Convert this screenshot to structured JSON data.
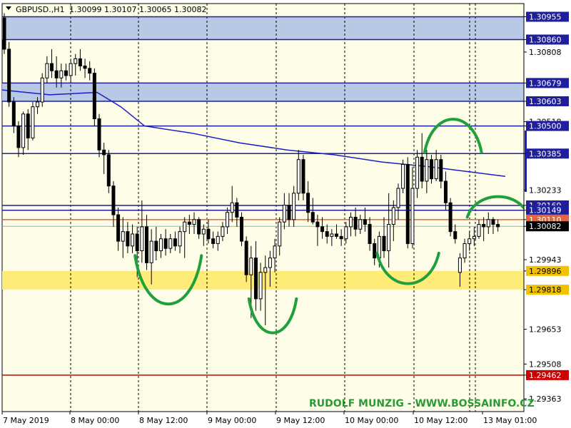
{
  "header": {
    "symbol": "GBPUSD.,H1",
    "ohlc": "1.30099 1.30107 1.30065 1.30082"
  },
  "watermark": "RUDOLF MUNZIG - WWW.BOSSAINFO.CZ",
  "colors": {
    "plot_background": "#fdfde8",
    "candle_bull": "#ffffff",
    "candle_bear": "#000000",
    "blue_zone": "#b7c9e4",
    "yellow_zone": "#ffec78",
    "level_line": "#1f1f9c",
    "ma_line": "#1c1cc8",
    "support_red": "#cc0000",
    "pattern_green": "#1f9f3d",
    "watermark": "#2a9a36"
  },
  "chart_data": {
    "type": "candlestick",
    "title": "GBPUSD.,H1",
    "ylim": [
      1.2931,
      1.3101
    ],
    "price_ticks": [
      "1.30955",
      "1.30860",
      "1.30808",
      "1.30679",
      "1.30603",
      "1.30518",
      "1.30500",
      "1.30385",
      "1.30233",
      "1.30169",
      "1.30149",
      "1.30110",
      "1.30082",
      "1.29943",
      "1.29896",
      "1.29818",
      "1.29653",
      "1.29508",
      "1.29462",
      "1.29363"
    ],
    "time_labels": [
      "7 May 2019",
      "8 May 00:00",
      "8 May 12:00",
      "9 May 00:00",
      "9 May 12:00",
      "10 May 00:00",
      "10 May 12:00",
      "13 May 01:00"
    ],
    "current_price": 1.30082,
    "zones": [
      {
        "from": 1.3086,
        "to": 1.30955,
        "kind": "resistance"
      },
      {
        "from": 1.30603,
        "to": 1.30679,
        "kind": "resistance"
      },
      {
        "from": 1.29818,
        "to": 1.29896,
        "kind": "support"
      }
    ],
    "levels": [
      {
        "price": 1.30955,
        "color": "#1f1f9c"
      },
      {
        "price": 1.3086,
        "color": "#1f1f9c"
      },
      {
        "price": 1.30679,
        "color": "#1f1f9c"
      },
      {
        "price": 1.30603,
        "color": "#1f1f9c"
      },
      {
        "price": 1.305,
        "color": "#1f1f9c"
      },
      {
        "price": 1.30385,
        "color": "#1f1f9c"
      },
      {
        "price": 1.30169,
        "color": "#1f1f9c"
      },
      {
        "price": 1.30149,
        "color": "#1f1f9c"
      },
      {
        "price": 1.3011,
        "color": "#e2663a"
      },
      {
        "price": 1.30082,
        "color": "#aaaaaa"
      },
      {
        "price": 1.29462,
        "color": "#cc0000"
      }
    ],
    "series": [
      {
        "type": "candlestick",
        "candles": [
          {
            "o": 1.3095,
            "h": 1.3097,
            "l": 1.308,
            "c": 1.3082
          },
          {
            "o": 1.3082,
            "h": 1.3085,
            "l": 1.3058,
            "c": 1.306
          },
          {
            "o": 1.306,
            "h": 1.3062,
            "l": 1.3047,
            "c": 1.305
          },
          {
            "o": 1.305,
            "h": 1.3052,
            "l": 1.3037,
            "c": 1.3041
          },
          {
            "o": 1.3041,
            "h": 1.3056,
            "l": 1.3038,
            "c": 1.3055
          },
          {
            "o": 1.3055,
            "h": 1.3057,
            "l": 1.304,
            "c": 1.3045
          },
          {
            "o": 1.3045,
            "h": 1.306,
            "l": 1.3044,
            "c": 1.3058
          },
          {
            "o": 1.3058,
            "h": 1.3062,
            "l": 1.3055,
            "c": 1.306
          },
          {
            "o": 1.306,
            "h": 1.3072,
            "l": 1.3058,
            "c": 1.307
          },
          {
            "o": 1.307,
            "h": 1.3079,
            "l": 1.3068,
            "c": 1.3076
          },
          {
            "o": 1.3076,
            "h": 1.3082,
            "l": 1.307,
            "c": 1.3073
          },
          {
            "o": 1.3073,
            "h": 1.3079,
            "l": 1.3066,
            "c": 1.307
          },
          {
            "o": 1.307,
            "h": 1.3076,
            "l": 1.3066,
            "c": 1.3073
          },
          {
            "o": 1.3073,
            "h": 1.3076,
            "l": 1.3069,
            "c": 1.3071
          },
          {
            "o": 1.3071,
            "h": 1.3078,
            "l": 1.3068,
            "c": 1.3076
          },
          {
            "o": 1.3076,
            "h": 1.308,
            "l": 1.3071,
            "c": 1.3078
          },
          {
            "o": 1.3078,
            "h": 1.3082,
            "l": 1.3073,
            "c": 1.3075
          },
          {
            "o": 1.3075,
            "h": 1.3078,
            "l": 1.307,
            "c": 1.3074
          },
          {
            "o": 1.3074,
            "h": 1.3077,
            "l": 1.3069,
            "c": 1.3072
          },
          {
            "o": 1.3072,
            "h": 1.3074,
            "l": 1.305,
            "c": 1.3053
          },
          {
            "o": 1.3053,
            "h": 1.3055,
            "l": 1.3037,
            "c": 1.304
          },
          {
            "o": 1.304,
            "h": 1.3043,
            "l": 1.303,
            "c": 1.3038
          },
          {
            "o": 1.3038,
            "h": 1.304,
            "l": 1.3022,
            "c": 1.3025
          },
          {
            "o": 1.3025,
            "h": 1.3027,
            "l": 1.3008,
            "c": 1.3013
          },
          {
            "o": 1.3013,
            "h": 1.3016,
            "l": 1.2998,
            "c": 1.3002
          },
          {
            "o": 1.3002,
            "h": 1.3012,
            "l": 1.2995,
            "c": 1.3006
          },
          {
            "o": 1.3006,
            "h": 1.301,
            "l": 1.2997,
            "c": 1.3
          },
          {
            "o": 1.3,
            "h": 1.3009,
            "l": 1.2997,
            "c": 1.3005
          },
          {
            "o": 1.3005,
            "h": 1.3008,
            "l": 1.2987,
            "c": 1.2998
          },
          {
            "o": 1.2998,
            "h": 1.3019,
            "l": 1.2993,
            "c": 1.3008
          },
          {
            "o": 1.3008,
            "h": 1.3013,
            "l": 1.299,
            "c": 1.2993
          },
          {
            "o": 1.2993,
            "h": 1.3007,
            "l": 1.2984,
            "c": 1.3002
          },
          {
            "o": 1.3002,
            "h": 1.3008,
            "l": 1.2994,
            "c": 1.2998
          },
          {
            "o": 1.2998,
            "h": 1.3005,
            "l": 1.2995,
            "c": 1.3003
          },
          {
            "o": 1.3003,
            "h": 1.3007,
            "l": 1.2996,
            "c": 1.2999
          },
          {
            "o": 1.2999,
            "h": 1.3005,
            "l": 1.2997,
            "c": 1.3003
          },
          {
            "o": 1.3003,
            "h": 1.3006,
            "l": 1.2998,
            "c": 1.3
          },
          {
            "o": 1.3,
            "h": 1.3008,
            "l": 1.2997,
            "c": 1.3006
          },
          {
            "o": 1.3006,
            "h": 1.3012,
            "l": 1.2995,
            "c": 1.301
          },
          {
            "o": 1.301,
            "h": 1.3013,
            "l": 1.3005,
            "c": 1.3009
          },
          {
            "o": 1.3009,
            "h": 1.3014,
            "l": 1.3005,
            "c": 1.3011
          },
          {
            "o": 1.3011,
            "h": 1.3012,
            "l": 1.3003,
            "c": 1.3005
          },
          {
            "o": 1.3005,
            "h": 1.3009,
            "l": 1.3,
            "c": 1.3007
          },
          {
            "o": 1.3007,
            "h": 1.3011,
            "l": 1.3001,
            "c": 1.3003
          },
          {
            "o": 1.3003,
            "h": 1.3006,
            "l": 1.2999,
            "c": 1.3001
          },
          {
            "o": 1.3001,
            "h": 1.3006,
            "l": 1.2998,
            "c": 1.3004
          },
          {
            "o": 1.3004,
            "h": 1.301,
            "l": 1.3002,
            "c": 1.3008
          },
          {
            "o": 1.3008,
            "h": 1.3016,
            "l": 1.3005,
            "c": 1.3014
          },
          {
            "o": 1.3014,
            "h": 1.3025,
            "l": 1.301,
            "c": 1.3018
          },
          {
            "o": 1.3018,
            "h": 1.302,
            "l": 1.3008,
            "c": 1.3012
          },
          {
            "o": 1.3012,
            "h": 1.3014,
            "l": 1.3,
            "c": 1.3002
          },
          {
            "o": 1.3002,
            "h": 1.3004,
            "l": 1.2985,
            "c": 1.2988
          },
          {
            "o": 1.2988,
            "h": 1.3,
            "l": 1.297,
            "c": 1.2995
          },
          {
            "o": 1.2995,
            "h": 1.3002,
            "l": 1.2973,
            "c": 1.2978
          },
          {
            "o": 1.2978,
            "h": 1.2993,
            "l": 1.2973,
            "c": 1.2989
          },
          {
            "o": 1.2989,
            "h": 1.2996,
            "l": 1.2967,
            "c": 1.2991
          },
          {
            "o": 1.2991,
            "h": 1.2998,
            "l": 1.2983,
            "c": 1.2995
          },
          {
            "o": 1.2995,
            "h": 1.3003,
            "l": 1.2989,
            "c": 1.3
          },
          {
            "o": 1.3,
            "h": 1.3012,
            "l": 1.2996,
            "c": 1.301
          },
          {
            "o": 1.301,
            "h": 1.3022,
            "l": 1.3007,
            "c": 1.3017
          },
          {
            "o": 1.3017,
            "h": 1.3022,
            "l": 1.3008,
            "c": 1.3011
          },
          {
            "o": 1.3011,
            "h": 1.3025,
            "l": 1.3008,
            "c": 1.3022
          },
          {
            "o": 1.3022,
            "h": 1.304,
            "l": 1.3019,
            "c": 1.3036
          },
          {
            "o": 1.3036,
            "h": 1.3038,
            "l": 1.3019,
            "c": 1.3022
          },
          {
            "o": 1.3022,
            "h": 1.3027,
            "l": 1.301,
            "c": 1.3014
          },
          {
            "o": 1.3014,
            "h": 1.302,
            "l": 1.3009,
            "c": 1.301
          },
          {
            "o": 1.301,
            "h": 1.3013,
            "l": 1.3,
            "c": 1.3008
          },
          {
            "o": 1.3008,
            "h": 1.3012,
            "l": 1.3003,
            "c": 1.3006
          },
          {
            "o": 1.3006,
            "h": 1.3009,
            "l": 1.3001,
            "c": 1.3004
          },
          {
            "o": 1.3004,
            "h": 1.3007,
            "l": 1.3,
            "c": 1.3005
          },
          {
            "o": 1.3005,
            "h": 1.3009,
            "l": 1.3003,
            "c": 1.3004
          },
          {
            "o": 1.3004,
            "h": 1.3007,
            "l": 1.3,
            "c": 1.3003
          },
          {
            "o": 1.3003,
            "h": 1.301,
            "l": 1.3001,
            "c": 1.3008
          },
          {
            "o": 1.3008,
            "h": 1.3014,
            "l": 1.3004,
            "c": 1.3012
          },
          {
            "o": 1.3012,
            "h": 1.3016,
            "l": 1.3004,
            "c": 1.3007
          },
          {
            "o": 1.3007,
            "h": 1.3013,
            "l": 1.3005,
            "c": 1.3011
          },
          {
            "o": 1.3011,
            "h": 1.3016,
            "l": 1.3006,
            "c": 1.3009
          },
          {
            "o": 1.3009,
            "h": 1.3012,
            "l": 1.2998,
            "c": 1.3001
          },
          {
            "o": 1.3001,
            "h": 1.3003,
            "l": 1.2992,
            "c": 1.2995
          },
          {
            "o": 1.2995,
            "h": 1.3006,
            "l": 1.2991,
            "c": 1.3004
          },
          {
            "o": 1.3004,
            "h": 1.3012,
            "l": 1.2995,
            "c": 1.2998
          },
          {
            "o": 1.2998,
            "h": 1.3022,
            "l": 1.2991,
            "c": 1.3009
          },
          {
            "o": 1.3009,
            "h": 1.3019,
            "l": 1.3002,
            "c": 1.3016
          },
          {
            "o": 1.3016,
            "h": 1.3026,
            "l": 1.3011,
            "c": 1.3024
          },
          {
            "o": 1.3024,
            "h": 1.3036,
            "l": 1.3022,
            "c": 1.3034
          },
          {
            "o": 1.3034,
            "h": 1.3037,
            "l": 1.2999,
            "c": 1.3001
          },
          {
            "o": 1.3001,
            "h": 1.3033,
            "l": 1.2999,
            "c": 1.3024
          },
          {
            "o": 1.3024,
            "h": 1.304,
            "l": 1.302,
            "c": 1.3037
          },
          {
            "o": 1.3037,
            "h": 1.3047,
            "l": 1.3024,
            "c": 1.3027
          },
          {
            "o": 1.3027,
            "h": 1.304,
            "l": 1.3022,
            "c": 1.3036
          },
          {
            "o": 1.3036,
            "h": 1.3038,
            "l": 1.3026,
            "c": 1.3028
          },
          {
            "o": 1.3028,
            "h": 1.304,
            "l": 1.3027,
            "c": 1.3036
          },
          {
            "o": 1.3036,
            "h": 1.3038,
            "l": 1.3024,
            "c": 1.3027
          },
          {
            "o": 1.3027,
            "h": 1.3031,
            "l": 1.3015,
            "c": 1.3018
          },
          {
            "o": 1.3018,
            "h": 1.302,
            "l": 1.3004,
            "c": 1.3006
          },
          {
            "o": 1.3006,
            "h": 1.3009,
            "l": 1.3001,
            "c": 1.3003
          },
          {
            "o": 1.2989,
            "h": 1.2997,
            "l": 1.2983,
            "c": 1.2995
          },
          {
            "o": 1.2995,
            "h": 1.3003,
            "l": 1.2993,
            "c": 1.3001
          },
          {
            "o": 1.3001,
            "h": 1.3006,
            "l": 1.2998,
            "c": 1.3003
          },
          {
            "o": 1.3003,
            "h": 1.3008,
            "l": 1.3,
            "c": 1.3004
          },
          {
            "o": 1.3004,
            "h": 1.3011,
            "l": 1.3003,
            "c": 1.3009
          },
          {
            "o": 1.3009,
            "h": 1.3012,
            "l": 1.3002,
            "c": 1.3008
          },
          {
            "o": 1.3008,
            "h": 1.3014,
            "l": 1.3005,
            "c": 1.3011
          },
          {
            "o": 1.3011,
            "h": 1.3012,
            "l": 1.3005,
            "c": 1.3009
          },
          {
            "o": 1.3009,
            "h": 1.3011,
            "l": 1.3006,
            "c": 1.3008
          }
        ]
      },
      {
        "type": "line",
        "points": [
          {
            "i": 0,
            "v": 1.3065
          },
          {
            "i": 10,
            "v": 1.3063
          },
          {
            "i": 20,
            "v": 1.3064
          },
          {
            "i": 25,
            "v": 1.3058
          },
          {
            "i": 30,
            "v": 1.305
          },
          {
            "i": 40,
            "v": 1.3047
          },
          {
            "i": 50,
            "v": 1.3043
          },
          {
            "i": 60,
            "v": 1.304
          },
          {
            "i": 70,
            "v": 1.3038
          },
          {
            "i": 80,
            "v": 1.3035
          },
          {
            "i": 90,
            "v": 1.3033
          },
          {
            "i": 98,
            "v": 1.3031
          },
          {
            "i": 106,
            "v": 1.3029
          }
        ]
      }
    ],
    "annotations": [
      {
        "type": "arc",
        "kind": "cup",
        "from_i": 28,
        "to_i": 42,
        "bottom": 1.2978,
        "top": 1.2996
      },
      {
        "type": "arc",
        "kind": "cup",
        "from_i": 52,
        "to_i": 62,
        "bottom": 1.2968,
        "top": 1.2978
      },
      {
        "type": "arc",
        "kind": "cup",
        "from_i": 79,
        "to_i": 92,
        "bottom": 1.2989,
        "top": 1.2997
      },
      {
        "type": "arc",
        "kind": "cap",
        "from_i": 89,
        "to_i": 101,
        "bottom": 1.3039,
        "top": 1.305
      },
      {
        "type": "arc",
        "kind": "cap",
        "from_i": 98,
        "to_i": 111,
        "bottom": 1.3012,
        "top": 1.3016
      }
    ]
  }
}
